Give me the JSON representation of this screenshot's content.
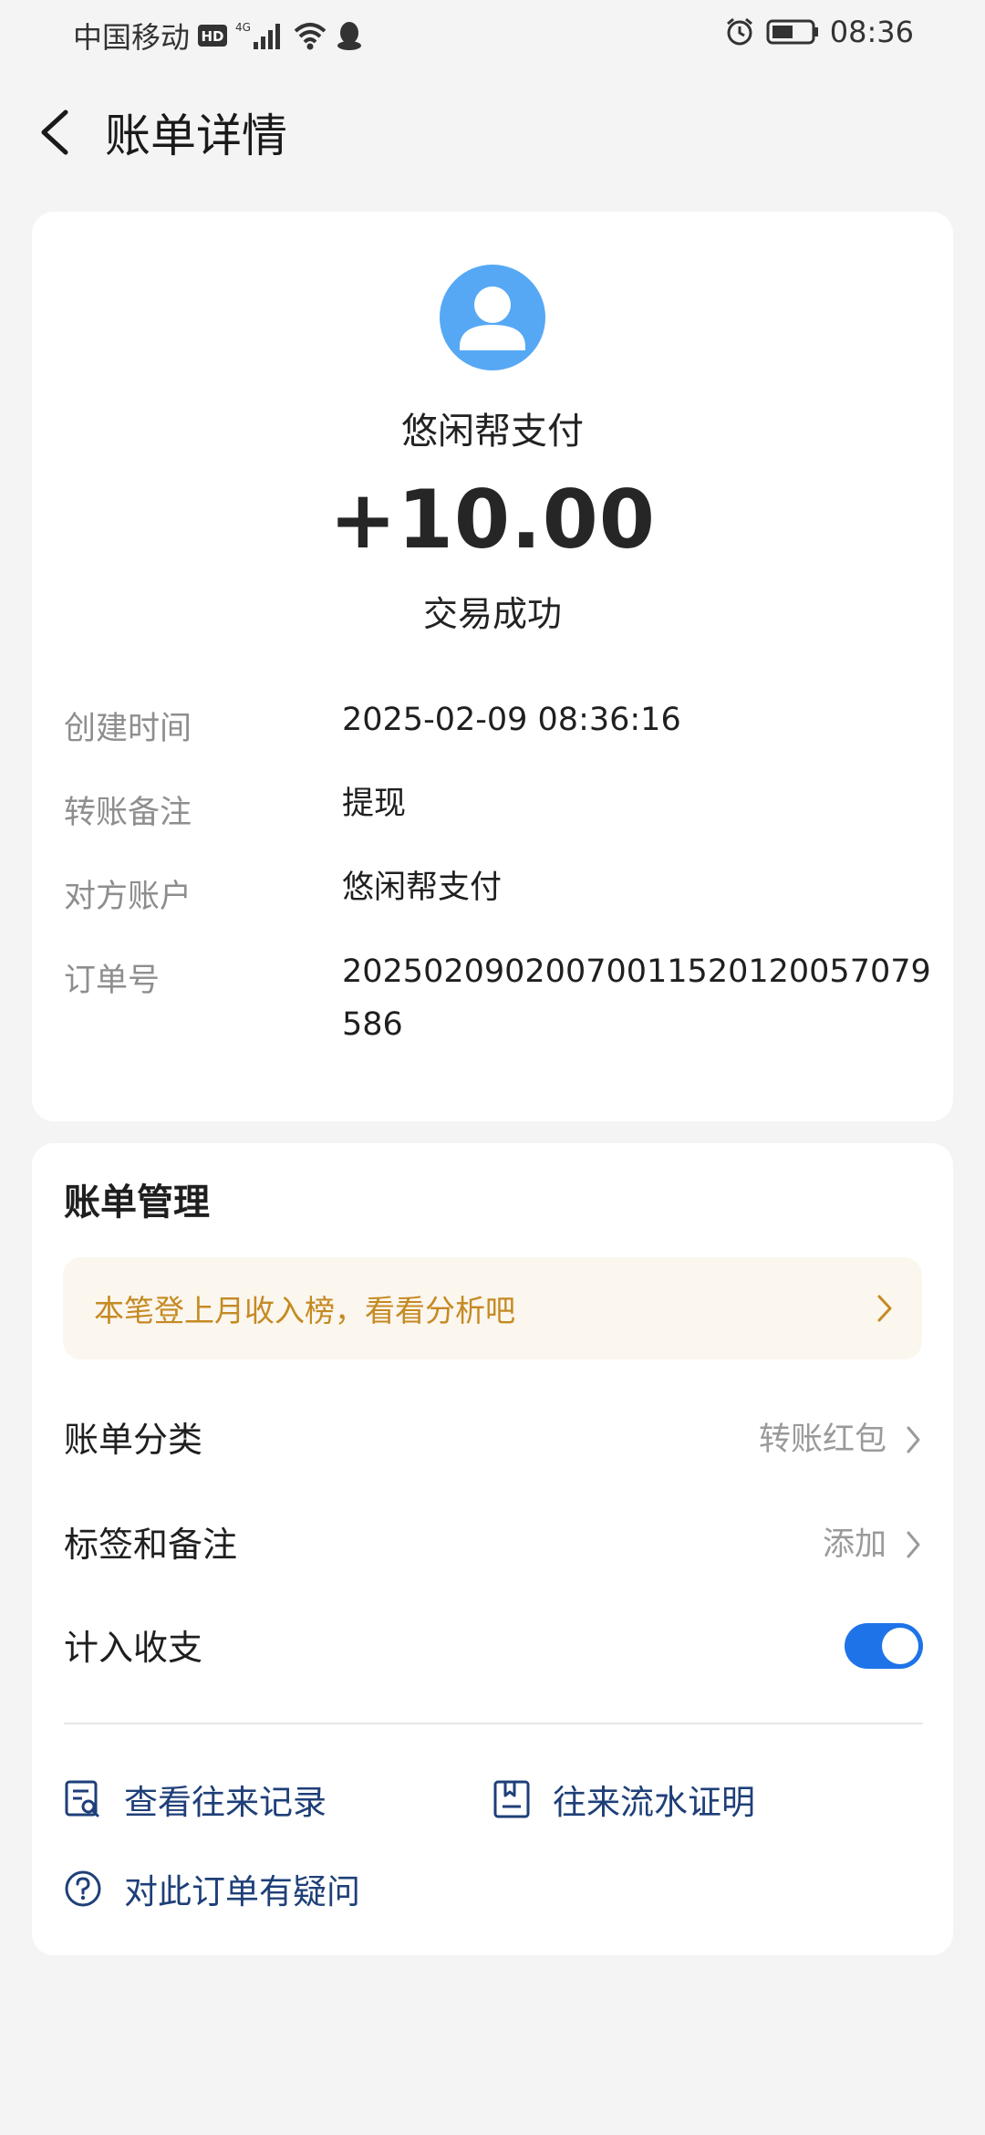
{
  "status_bar": {
    "carrier": "中国移动",
    "hd_badge": "HD",
    "network": "4G",
    "time": "08:36",
    "icons": [
      "signal-icon",
      "wifi-icon",
      "qq-icon",
      "alarm-icon",
      "battery-icon"
    ]
  },
  "header": {
    "title": "账单详情"
  },
  "summary": {
    "avatar_icon": "person-avatar-icon",
    "payer_name": "悠闲帮支付",
    "amount": "+10.00",
    "status": "交易成功"
  },
  "details": [
    {
      "label": "创建时间",
      "value": "2025-02-09 08:36:16"
    },
    {
      "label": "转账备注",
      "value": "提现"
    },
    {
      "label": "对方账户",
      "value": "悠闲帮支付"
    },
    {
      "label": "订单号",
      "value": "20250209020070011520120057079586"
    }
  ],
  "management": {
    "title": "账单管理",
    "promo_text": "本笔登上月收入榜，看看分析吧",
    "category_label": "账单分类",
    "category_value": "转账红包",
    "tags_label": "标签和备注",
    "tags_value": "添加",
    "include_label": "计入收支",
    "include_enabled": true
  },
  "actions": {
    "view_records": "查看往来记录",
    "statement": "往来流水证明",
    "question": "对此订单有疑问"
  },
  "colors": {
    "background": "#f4f4f4",
    "card": "#ffffff",
    "avatar": "#56a8f5",
    "promo_bg": "#fbf6ee",
    "promo_text": "#c58a22",
    "toggle_on": "#1e73e8",
    "link": "#1e3f78"
  }
}
